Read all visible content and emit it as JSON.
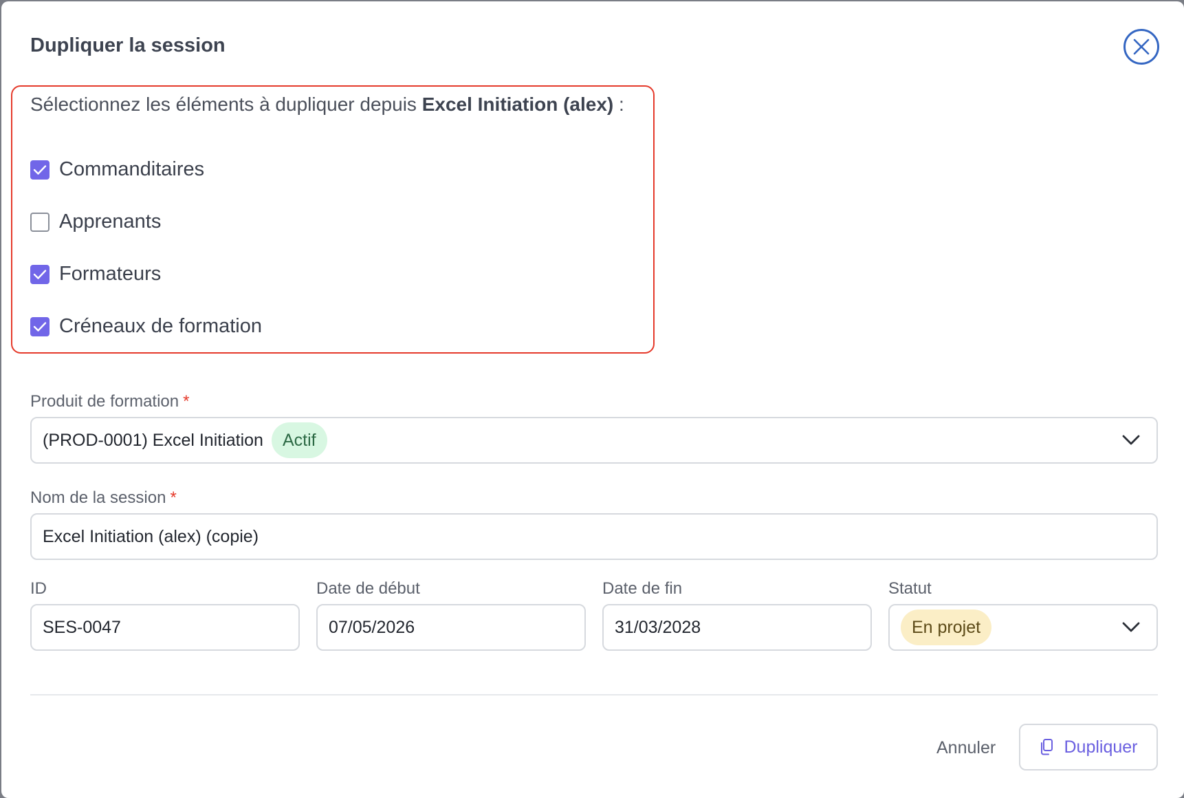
{
  "modal": {
    "title": "Dupliquer la session",
    "close_icon": "close-icon"
  },
  "selection": {
    "intro_prefix": "Sélectionnez les éléments à dupliquer depuis ",
    "source_session": "Excel Initiation (alex)",
    "intro_suffix": " :",
    "options": [
      {
        "label": "Commanditaires",
        "checked": true
      },
      {
        "label": "Apprenants",
        "checked": false
      },
      {
        "label": "Formateurs",
        "checked": true
      },
      {
        "label": "Créneaux de formation",
        "checked": true
      }
    ]
  },
  "form": {
    "product": {
      "label": "Produit de formation",
      "required_mark": "*",
      "value": "(PROD-0001) Excel Initiation",
      "badge": "Actif",
      "badge_color": "#d8f7e2"
    },
    "session_name": {
      "label": "Nom de la session",
      "required_mark": "*",
      "value": "Excel Initiation (alex) (copie)"
    },
    "id": {
      "label": "ID",
      "value": "SES-0047"
    },
    "start_date": {
      "label": "Date de début",
      "value": "07/05/2026"
    },
    "end_date": {
      "label": "Date de fin",
      "value": "31/03/2028"
    },
    "status": {
      "label": "Statut",
      "value": "En projet",
      "badge_color": "#fbeec6"
    }
  },
  "footer": {
    "cancel_label": "Annuler",
    "duplicate_label": "Dupliquer",
    "duplicate_icon": "copy-icon"
  },
  "colors": {
    "accent": "#7166e8",
    "highlight_border": "#e5392a",
    "close_ring": "#3466c2"
  }
}
